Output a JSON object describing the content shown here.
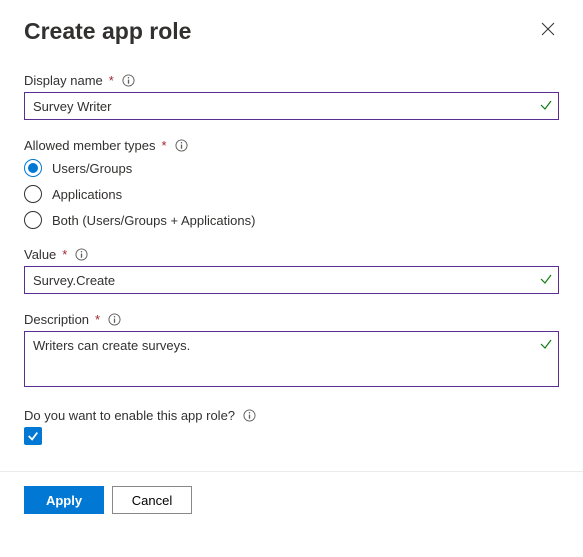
{
  "title": "Create app role",
  "fields": {
    "displayName": {
      "label": "Display name",
      "value": "Survey Writer"
    },
    "allowedMemberTypes": {
      "label": "Allowed member types",
      "options": [
        "Users/Groups",
        "Applications",
        "Both (Users/Groups + Applications)"
      ],
      "selected": 0
    },
    "value": {
      "label": "Value",
      "value": "Survey.Create"
    },
    "description": {
      "label": "Description",
      "value": "Writers can create surveys."
    },
    "enable": {
      "label": "Do you want to enable this app role?",
      "checked": true
    }
  },
  "buttons": {
    "apply": "Apply",
    "cancel": "Cancel"
  }
}
